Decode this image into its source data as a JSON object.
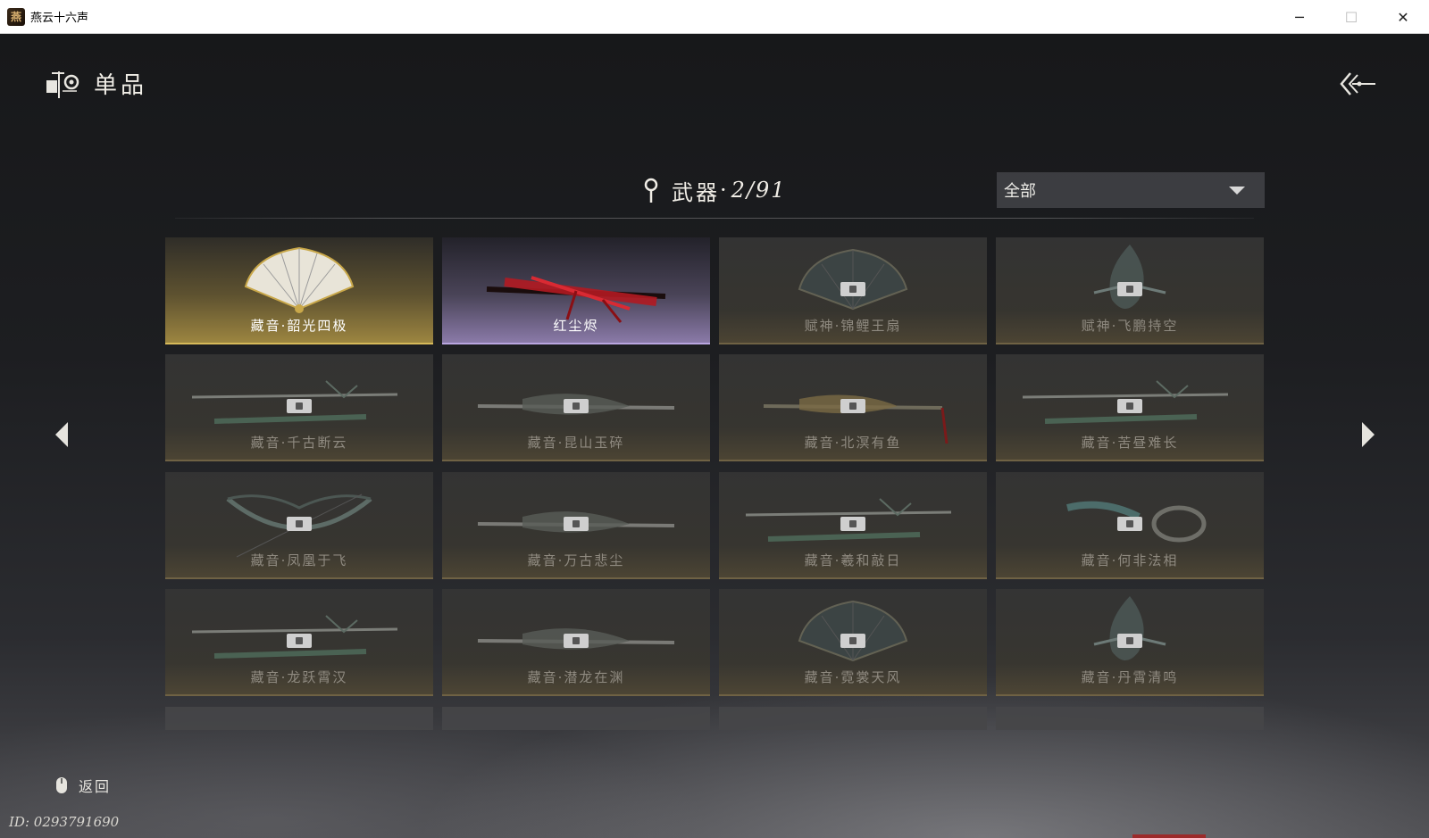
{
  "window": {
    "title": "燕云十六声",
    "controls": [
      "─",
      "☐",
      "✕"
    ]
  },
  "header": {
    "title": "单品"
  },
  "category": {
    "name": "武器",
    "separator": "·",
    "count": "2/91"
  },
  "filter": {
    "selected": "全部"
  },
  "items": [
    {
      "label": "藏音·韶光四极",
      "state": "gold",
      "art": "fan",
      "locked": false
    },
    {
      "label": "红尘烬",
      "state": "purple",
      "art": "red-staff",
      "locked": false
    },
    {
      "label": "赋神·锦鲤王扇",
      "state": "locked",
      "art": "fan-dark",
      "locked": true
    },
    {
      "label": "赋神·飞鹏持空",
      "state": "locked",
      "art": "wing",
      "locked": true
    },
    {
      "label": "藏音·千古断云",
      "state": "locked",
      "art": "sword-pair",
      "locked": true
    },
    {
      "label": "藏音·昆山玉碎",
      "state": "locked",
      "art": "spear",
      "locked": true
    },
    {
      "label": "藏音·北溟有鱼",
      "state": "locked",
      "art": "spear-gold",
      "locked": true
    },
    {
      "label": "藏音·苦昼难长",
      "state": "locked",
      "art": "sword-pair",
      "locked": true
    },
    {
      "label": "藏音·凤凰于飞",
      "state": "locked",
      "art": "bow",
      "locked": true
    },
    {
      "label": "藏音·万古悲尘",
      "state": "locked",
      "art": "spear",
      "locked": true
    },
    {
      "label": "藏音·羲和敲日",
      "state": "locked",
      "art": "sword-pair",
      "locked": true
    },
    {
      "label": "藏音·何非法相",
      "state": "locked",
      "art": "whip",
      "locked": true
    },
    {
      "label": "藏音·龙跃霄汉",
      "state": "locked",
      "art": "sword-pair",
      "locked": true
    },
    {
      "label": "藏音·潜龙在渊",
      "state": "locked",
      "art": "spear",
      "locked": true
    },
    {
      "label": "藏音·霓裳天风",
      "state": "locked",
      "art": "fan-dark",
      "locked": true
    },
    {
      "label": "藏音·丹霄清鸣",
      "state": "locked",
      "art": "wing",
      "locked": true
    }
  ],
  "footer": {
    "return_label": "返回",
    "player_id": "ID: 0293791690"
  },
  "colors": {
    "gold_accent": "#d6b95a",
    "purple_accent": "#b9a6e0",
    "locked_text": "#8f8a80"
  },
  "icons": {
    "header": "collection-emblem-icon",
    "back": "double-chevron-back-icon",
    "pin": "map-pin-icon",
    "dropdown": "triangle-down-icon",
    "prev": "triangle-left-icon",
    "next": "triangle-right-icon",
    "lock": "lock-icon",
    "mouse": "mouse-icon"
  }
}
